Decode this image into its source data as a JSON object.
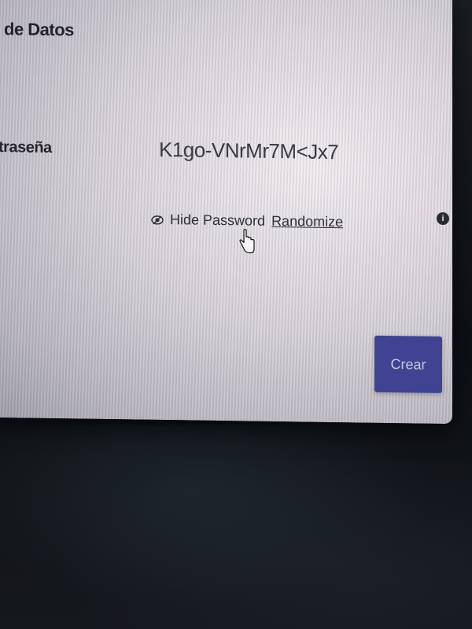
{
  "form": {
    "title": "de Datos",
    "password_label": "traseña",
    "password_value": "K1go-VNrMr7M<Jx7",
    "hide_password_label": "Hide Password",
    "randomize_label": "Randomize",
    "create_button_label": "Crear"
  },
  "icons": {
    "visibility": "eye-icon",
    "info": "info-icon",
    "cursor": "hand-pointer-icon"
  },
  "colors": {
    "primary_button": "#3f4392"
  }
}
